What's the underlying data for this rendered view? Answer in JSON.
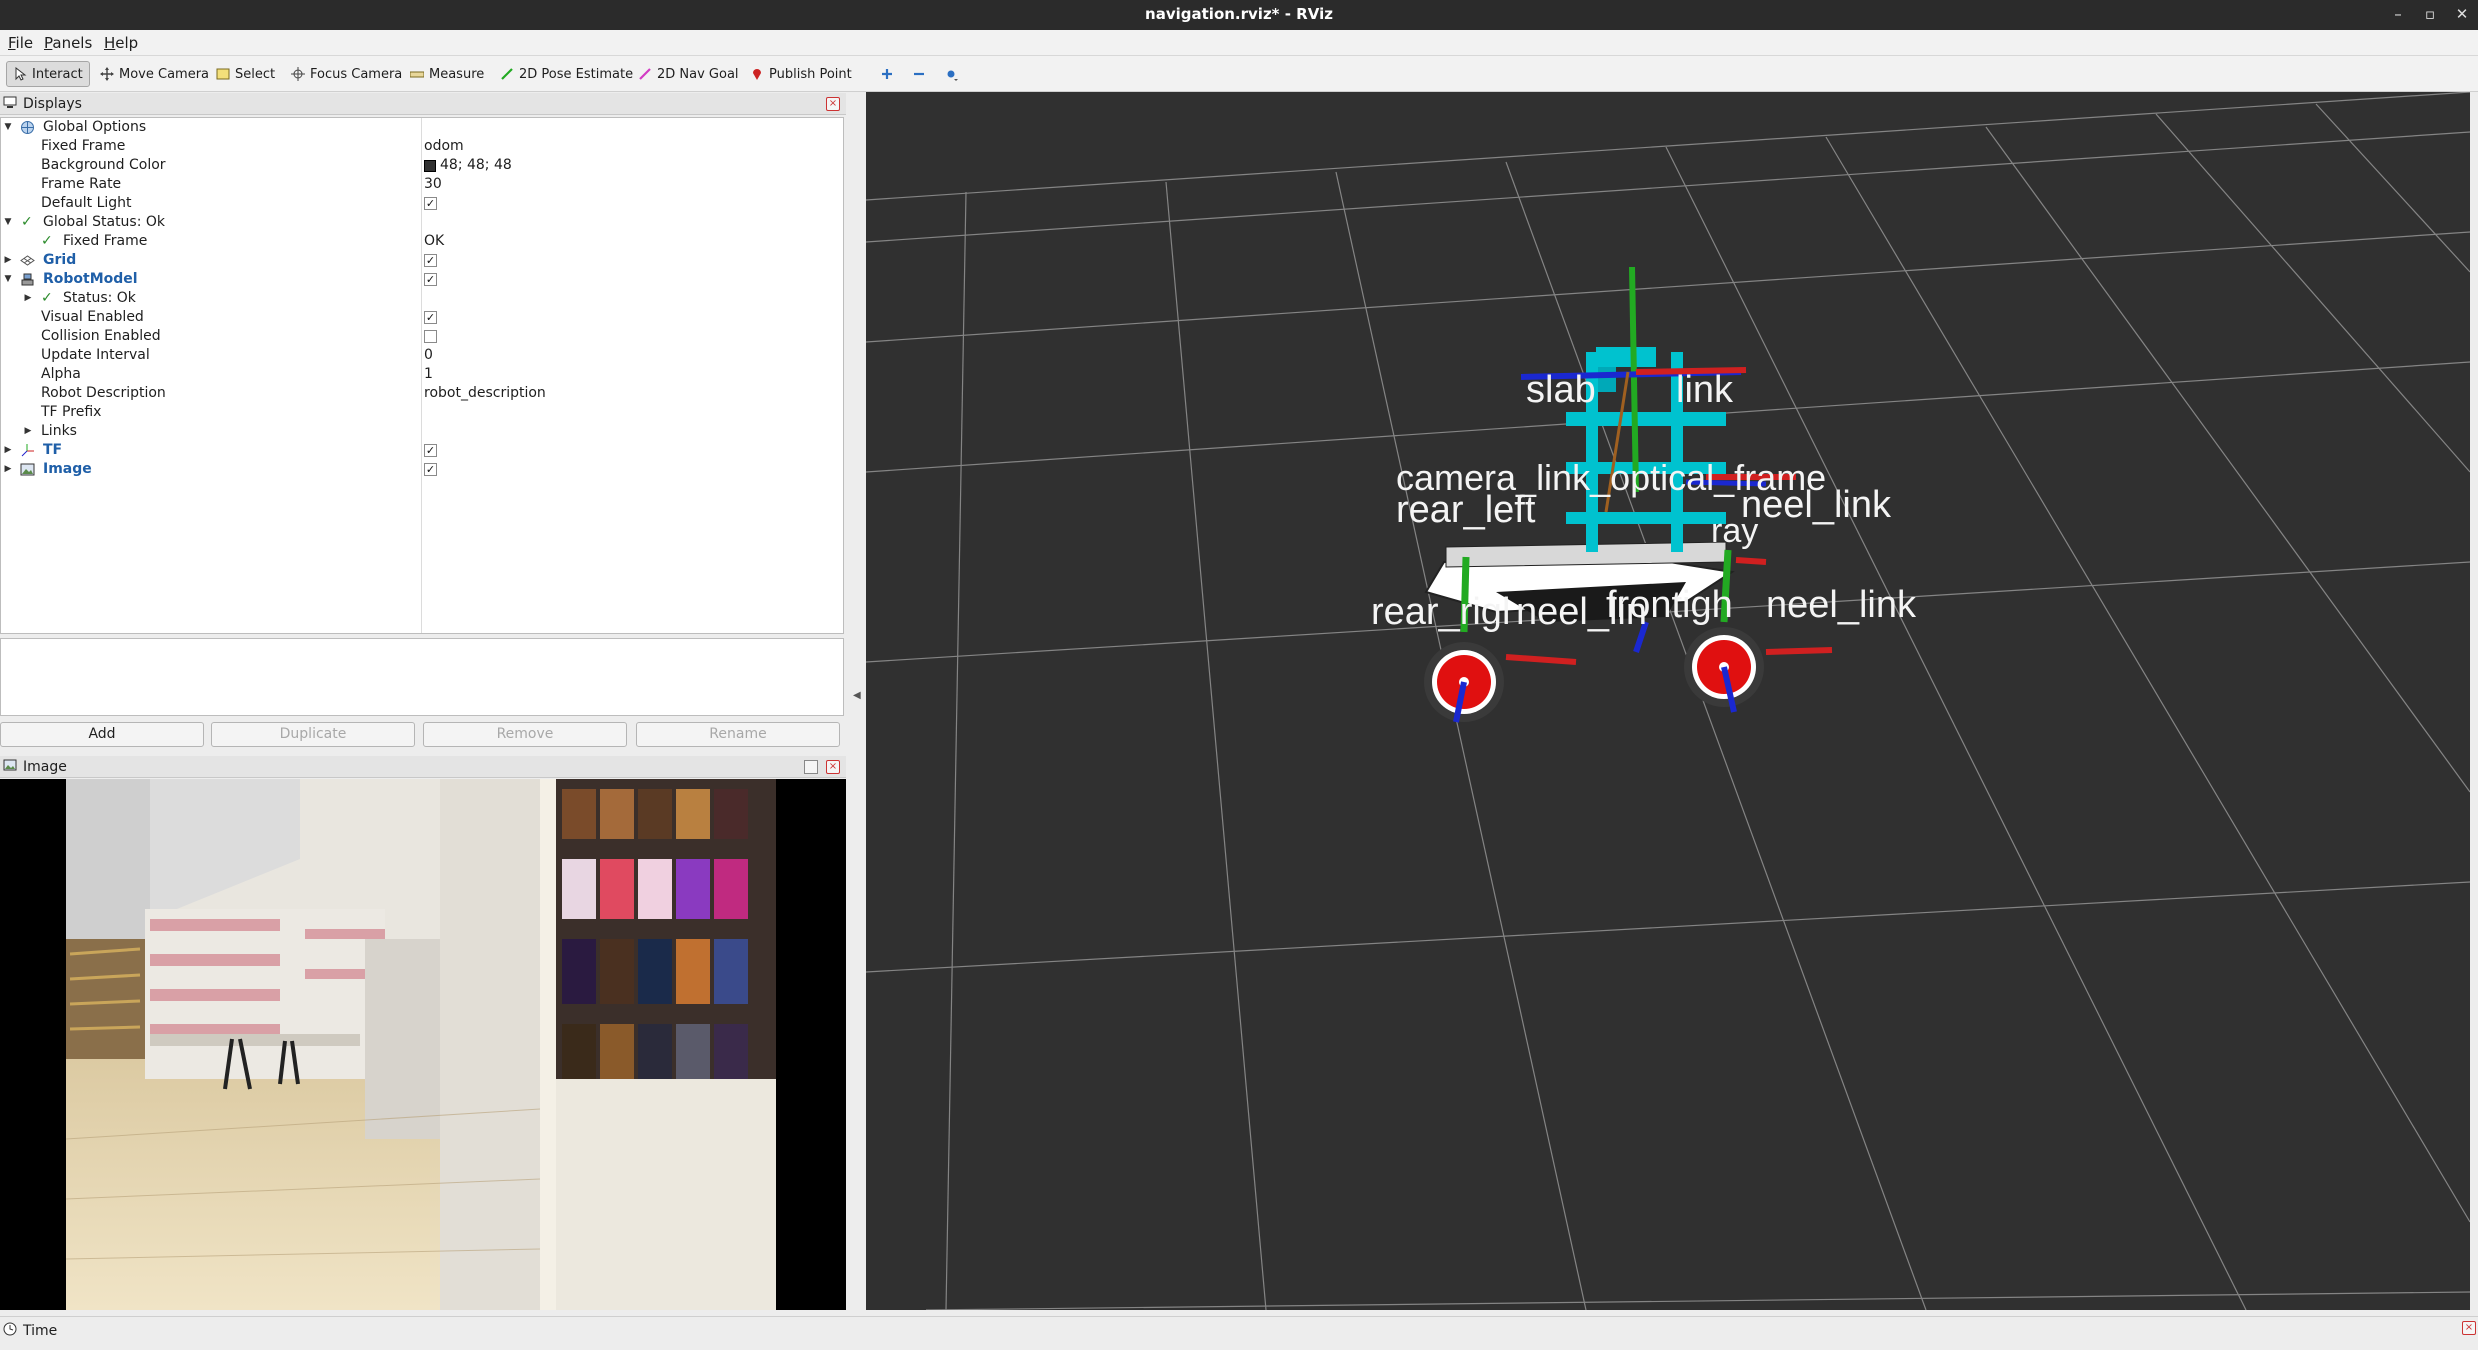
{
  "window": {
    "title": "navigation.rviz* - RViz"
  },
  "menu": {
    "file": "File",
    "panels": "Panels",
    "help": "Help"
  },
  "toolbar": {
    "interact": "Interact",
    "move_camera": "Move Camera",
    "select": "Select",
    "focus_camera": "Focus Camera",
    "measure": "Measure",
    "pose_estimate": "2D Pose Estimate",
    "nav_goal": "2D Nav Goal",
    "publish_point": "Publish Point"
  },
  "displays": {
    "title": "Displays",
    "rows": {
      "global_options": "Global Options",
      "fixed_frame_label": "Fixed Frame",
      "fixed_frame_value": "odom",
      "bg_color_label": "Background Color",
      "bg_color_value": "48; 48; 48",
      "frame_rate_label": "Frame Rate",
      "frame_rate_value": "30",
      "default_light_label": "Default Light",
      "global_status": "Global Status: Ok",
      "status_fixed_frame_label": "Fixed Frame",
      "status_fixed_frame_value": "OK",
      "grid": "Grid",
      "robot_model": "RobotModel",
      "status_ok": "Status: Ok",
      "visual_enabled": "Visual Enabled",
      "collision_enabled": "Collision Enabled",
      "update_interval_label": "Update Interval",
      "update_interval_value": "0",
      "alpha_label": "Alpha",
      "alpha_value": "1",
      "robot_desc_label": "Robot Description",
      "robot_desc_value": "robot_description",
      "tf_prefix": "TF Prefix",
      "links": "Links",
      "tf": "TF",
      "image": "Image"
    },
    "buttons": {
      "add": "Add",
      "duplicate": "Duplicate",
      "remove": "Remove",
      "rename": "Rename"
    }
  },
  "image_panel": {
    "title": "Image"
  },
  "viewport": {
    "labels": {
      "slab": "slab",
      "link": "link",
      "rear_left": "rear_left",
      "neel_link_right": "neel_link",
      "rear_rig": "rear_rigl",
      "neel_lin": "neel_lin",
      "frontigh": "frontigh",
      "neel_link_front": "neel_link",
      "camera_overlap": "camera_link_optical_frame",
      "ray": "ray"
    },
    "background": "#303030"
  },
  "time_panel": {
    "title": "Time"
  },
  "colors": {
    "accent": "#1f5fa8",
    "ok": "#2a8a2a",
    "close": "#cc3333"
  }
}
